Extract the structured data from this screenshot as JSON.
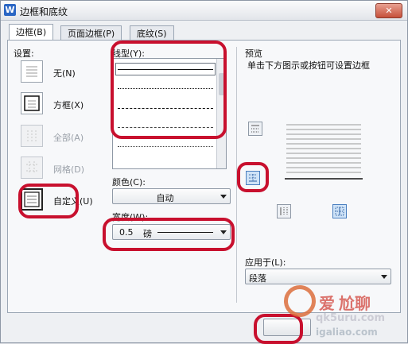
{
  "window": {
    "title": "边框和底纹",
    "app_icon": "W",
    "close_label": "✕"
  },
  "tabs": [
    {
      "label": "边框(B)"
    },
    {
      "label": "页面边框(P)"
    },
    {
      "label": "底纹(S)"
    }
  ],
  "settings": {
    "label": "设置:",
    "items": [
      {
        "label": "无(N)",
        "icon": "none-border-icon",
        "enabled": true
      },
      {
        "label": "方框(X)",
        "icon": "box-border-icon",
        "enabled": true
      },
      {
        "label": "全部(A)",
        "icon": "all-border-icon",
        "enabled": false
      },
      {
        "label": "网格(D)",
        "icon": "grid-border-icon",
        "enabled": false
      },
      {
        "label": "自定义(U)",
        "icon": "custom-border-icon",
        "enabled": true
      }
    ]
  },
  "line_style": {
    "label": "线型(Y):",
    "styles": [
      "solid",
      "dotted",
      "dashed",
      "dash-long",
      "dotted-fine"
    ]
  },
  "color": {
    "label": "颜色(C):",
    "value": "自动"
  },
  "width": {
    "label": "宽度(W):",
    "value_number": "0.5",
    "value_unit": "磅"
  },
  "preview": {
    "label": "预览",
    "hint": "单击下方图示或按钮可设置边框"
  },
  "apply_to": {
    "label": "应用于(L):",
    "value": "段落"
  },
  "watermark": {
    "text1": "爱",
    "text2": "尬聊",
    "url": "qk5uru.com",
    "url2": "igaliao.com"
  },
  "colors": {
    "accent": "#2a66c4",
    "highlight_oval": "#c8102e"
  }
}
